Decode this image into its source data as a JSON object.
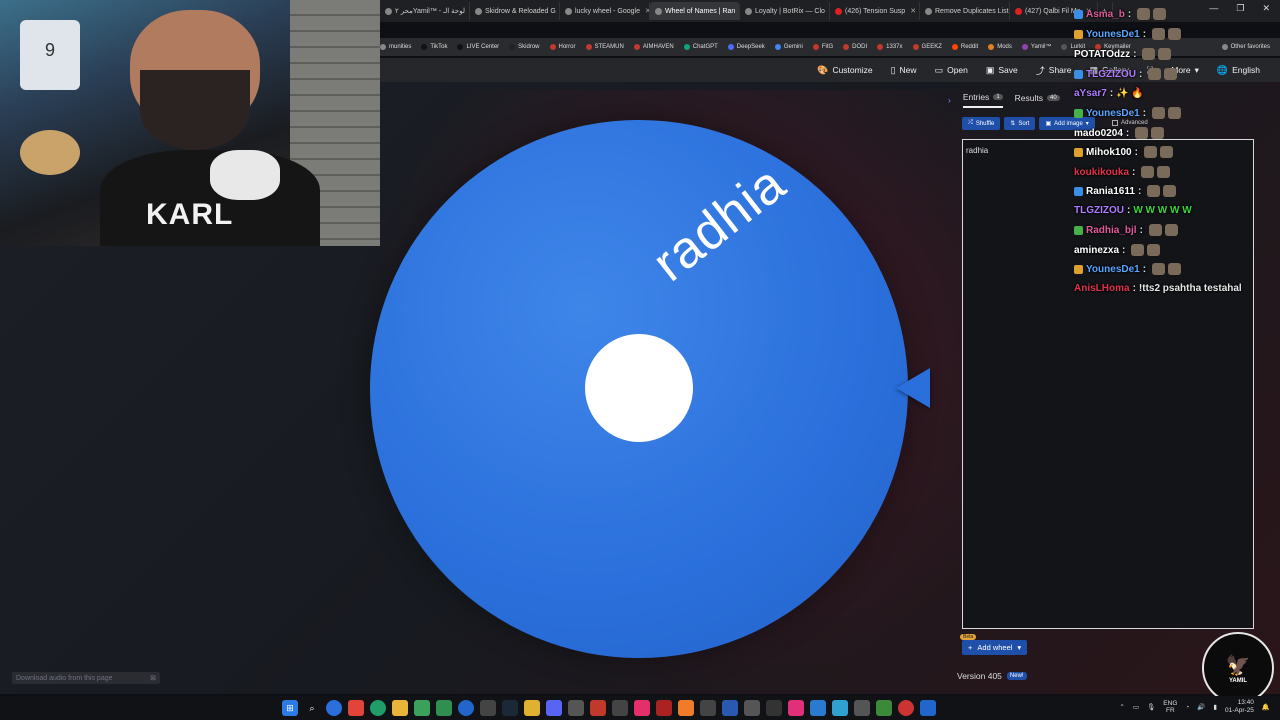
{
  "browser": {
    "tabs": [
      {
        "label": "محر ٢Yamil™ - لوحة الـ",
        "active": false
      },
      {
        "label": "Skidrow & Reloaded G",
        "active": false
      },
      {
        "label": "lucky wheel - Google",
        "active": false
      },
      {
        "label": "Wheel of Names | Ran",
        "active": true
      },
      {
        "label": "Loyalty | BotRix — Clo",
        "active": false
      },
      {
        "label": "(426) Tension Susp",
        "active": false
      },
      {
        "label": "Remove Duplicates List",
        "active": false
      },
      {
        "label": "(427) Qalbi Fil Ma",
        "active": false
      }
    ],
    "bookmarks": [
      {
        "label": "munities",
        "color": "#888888"
      },
      {
        "label": "TikTok",
        "color": "#111111"
      },
      {
        "label": "LIVE Center",
        "color": "#111111"
      },
      {
        "label": "Skidrow",
        "color": "#222222"
      },
      {
        "label": "Horror",
        "color": "#c0392b"
      },
      {
        "label": "STEAMUN",
        "color": "#c0392b"
      },
      {
        "label": "AIMHAVEN",
        "color": "#c0392b"
      },
      {
        "label": "ChatGPT",
        "color": "#10a37f"
      },
      {
        "label": "DeepSeek",
        "color": "#4d6bfe"
      },
      {
        "label": "Gemini",
        "color": "#4285f4"
      },
      {
        "label": "FitG",
        "color": "#c0392b"
      },
      {
        "label": "DODI",
        "color": "#c0392b"
      },
      {
        "label": "1337x",
        "color": "#c0392b"
      },
      {
        "label": "GEEKZ",
        "color": "#c0392b"
      },
      {
        "label": "Reddit",
        "color": "#ff4500"
      },
      {
        "label": "Mods",
        "color": "#e67e22"
      },
      {
        "label": "Yamil™",
        "color": "#8e44ad"
      },
      {
        "label": "Lurkit",
        "color": "#555555"
      },
      {
        "label": "Keymailer",
        "color": "#c0392b"
      },
      {
        "label": "Other favorites",
        "color": "#888888"
      }
    ]
  },
  "toolbar": {
    "customize": "Customize",
    "new": "New",
    "open": "Open",
    "save": "Save",
    "share": "Share",
    "gallery": "Gallery",
    "more": "More",
    "language": "English"
  },
  "wheel": {
    "segment_text": "radhia",
    "color": "#2a6fdb"
  },
  "panel": {
    "entries_tab": "Entries",
    "entries_count": "1",
    "results_tab": "Results",
    "results_count": "40",
    "shuffle": "Shuffle",
    "sort": "Sort",
    "add_image": "Add image",
    "advanced": "Advanced",
    "entries_text": "radhia",
    "beta": "Beta",
    "add_wheel": "Add wheel",
    "version": "Version 405",
    "new_badge": "New!"
  },
  "webcam": {
    "shirt_text": "KARL",
    "jersey_number": "9"
  },
  "chat": [
    {
      "user": "Asma_b",
      "color": "#e05a9b",
      "message": ""
    },
    {
      "user": "YounesDe1",
      "color": "#5aa5ff",
      "message": ""
    },
    {
      "user": "POTATOdzz",
      "color": "#ffffff",
      "message": ""
    },
    {
      "user": "TLGZIZOU",
      "color": "#b07cff",
      "message": ""
    },
    {
      "user": "aYsar7",
      "color": "#b07cff",
      "message": "✨ 🔥"
    },
    {
      "user": "YounesDe1",
      "color": "#5aa5ff",
      "message": ""
    },
    {
      "user": "mado0204",
      "color": "#ffffff",
      "message": ""
    },
    {
      "user": "Mihok100",
      "color": "#ffffff",
      "message": ""
    },
    {
      "user": "koukikouka",
      "color": "#e0304a",
      "message": ""
    },
    {
      "user": "Rania1611",
      "color": "#ffffff",
      "message": ""
    },
    {
      "user": "TLGZIZOU",
      "color": "#b07cff",
      "message": "W W W W W"
    },
    {
      "user": "Radhia_bjl",
      "color": "#e05a9b",
      "message": ""
    },
    {
      "user": "aminezxa",
      "color": "#ffffff",
      "message": ""
    },
    {
      "user": "YounesDe1",
      "color": "#5aa5ff",
      "message": ""
    },
    {
      "user": "AnisLHoma",
      "color": "#e0304a",
      "message": "!tts2 psahtha testahal"
    }
  ],
  "overlay": {
    "download_audio": "Download audio from this page"
  },
  "taskbar": {
    "lang_top": "ENG",
    "lang_bottom": "FR",
    "time": "13:40",
    "date": "01-Apr-25"
  },
  "logo": {
    "text": "YAMIL"
  }
}
